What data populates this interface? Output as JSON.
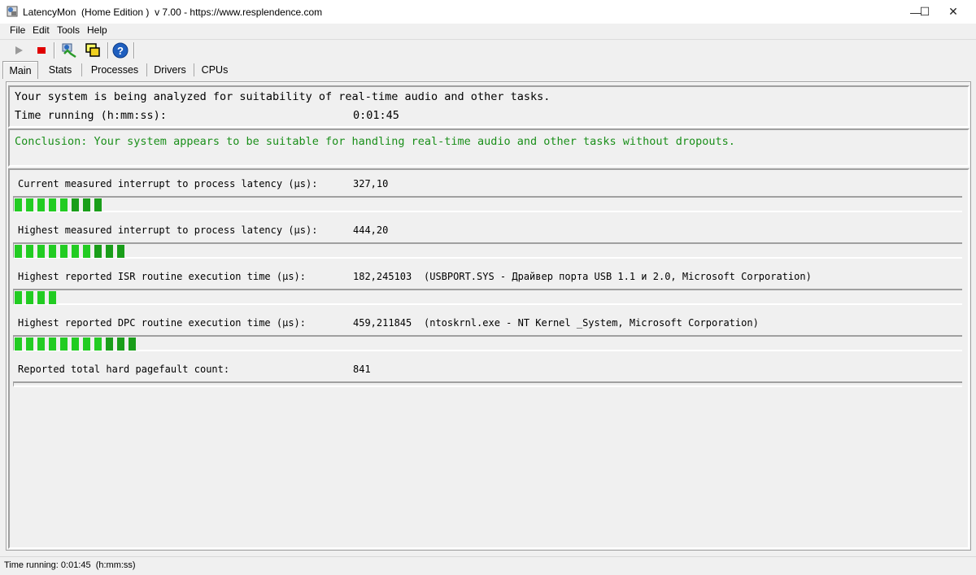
{
  "window": {
    "title": "LatencyMon  (Home Edition )  v 7.00 - https://www.resplendence.com",
    "controls": {
      "minimize": "—",
      "maximize": "☐",
      "close": "✕"
    }
  },
  "menu": [
    "File",
    "Edit",
    "Tools",
    "Help"
  ],
  "toolbar": {
    "buttons": [
      "play-icon",
      "stop-icon",
      "process-monitor-icon",
      "windows-icon",
      "help-icon"
    ],
    "colors": {
      "stop": "#e00000",
      "help": "#1f5fbf"
    }
  },
  "tabs": [
    "Main",
    "Stats",
    "Processes",
    "Drivers",
    "CPUs"
  ],
  "active_tab": "Main",
  "summary": {
    "line1": "Your system is being analyzed for suitability of real-time audio and other tasks.",
    "time_label": "Time running (h:mm:ss):",
    "time_value": "0:01:45"
  },
  "conclusion": {
    "text": "Conclusion: Your system appears to be suitable for handling real-time audio and other tasks without dropouts.",
    "color": "#1a8f1a"
  },
  "metrics": [
    {
      "label": "Current measured interrupt to process latency (µs):",
      "value": "327,10",
      "detail": "",
      "segments": 8
    },
    {
      "label": "Highest measured interrupt to process latency (µs):",
      "value": "444,20",
      "detail": "",
      "segments": 10
    },
    {
      "label": "Highest reported ISR routine execution time (µs):",
      "value": "182,245103",
      "detail": "(USBPORT.SYS - Драйвер порта USB 1.1 и 2.0, Microsoft Corporation)",
      "segments": 4
    },
    {
      "label": "Highest reported DPC routine execution time (µs):",
      "value": "459,211845",
      "detail": "(ntoskrnl.exe - NT Kernel _System, Microsoft Corporation)",
      "segments": 11
    },
    {
      "label": "Reported total hard pagefault count:",
      "value": "841",
      "detail": "",
      "segments": 0
    }
  ],
  "status": {
    "text": "Time running: 0:01:45  (h:mm:ss)"
  },
  "colors": {
    "bar_green": "#22cc22",
    "bar_green_dark": "#1a9e1a"
  }
}
